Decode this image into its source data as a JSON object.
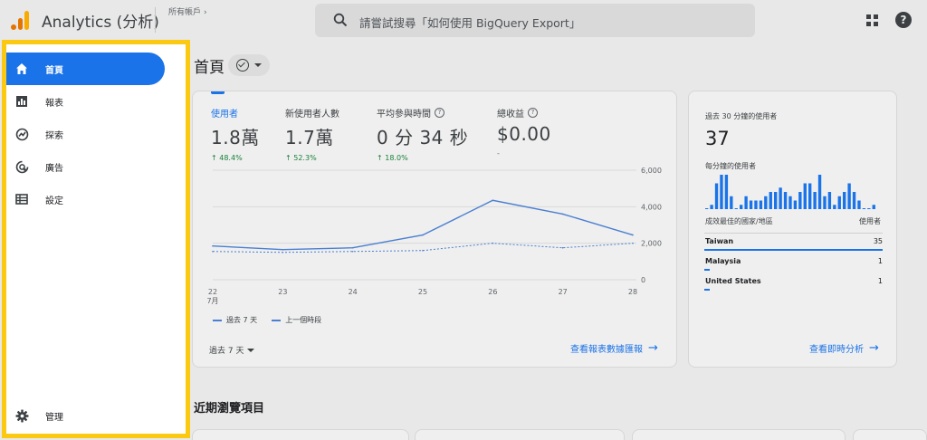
{
  "header": {
    "app_title": "Analytics (分析)",
    "breadcrumb": "所有帳戶",
    "search_placeholder": "請嘗試搜尋「如何使用 BigQuery Export」"
  },
  "sidebar": {
    "items": [
      {
        "label": "首頁",
        "icon": "home-icon",
        "active": true
      },
      {
        "label": "報表",
        "icon": "reports-icon"
      },
      {
        "label": "探索",
        "icon": "explore-icon"
      },
      {
        "label": "廣告",
        "icon": "advertising-icon"
      },
      {
        "label": "設定",
        "icon": "configure-icon"
      }
    ],
    "admin": {
      "label": "管理",
      "icon": "gear-icon"
    },
    "highlight_color": "#fcc912"
  },
  "main": {
    "page_title": "首頁",
    "metrics": [
      {
        "label": "使用者",
        "value": "1.8萬",
        "change": "48.4%",
        "active": true
      },
      {
        "label": "新使用者人數",
        "value": "1.7萬",
        "change": "52.3%"
      },
      {
        "label": "平均參與時間",
        "value": "0 分 34 秒",
        "change": "18.0%",
        "help": true
      },
      {
        "label": "總收益",
        "value": "$0.00",
        "change": "-",
        "help": true
      }
    ],
    "chart_data": {
      "type": "line",
      "x": [
        "22",
        "23",
        "24",
        "25",
        "26",
        "27",
        "28"
      ],
      "x_month_label": "7月",
      "y_ticks": [
        "6,000",
        "4,000",
        "2,000",
        "0"
      ],
      "ylim": [
        0,
        6000
      ],
      "series": [
        {
          "name": "過去 7 天",
          "style": "solid",
          "values": [
            1850,
            1650,
            1750,
            2450,
            4350,
            3600,
            2450
          ]
        },
        {
          "name": "上一個時段",
          "style": "dashed",
          "values": [
            1550,
            1500,
            1550,
            1600,
            2000,
            1750,
            2000
          ]
        }
      ]
    },
    "date_range_label": "過去 7 天",
    "view_reports_link": "查看報表數據匯報"
  },
  "realtime": {
    "label": "過去 30 分鐘的使用者",
    "value": "37",
    "per_minute_label": "每分鐘的使用者",
    "per_minute_values": [
      0,
      1,
      6,
      8,
      8,
      3,
      0,
      1,
      3,
      2,
      2,
      2,
      3,
      4,
      4,
      5,
      4,
      3,
      2,
      4,
      6,
      6,
      4,
      8,
      3,
      4,
      1,
      3,
      4,
      6,
      4,
      2,
      0,
      0,
      1
    ],
    "table_header_country": "成效最佳的國家/地區",
    "table_header_users": "使用者",
    "countries": [
      {
        "name": "Taiwan",
        "users": "35",
        "share": 1.0
      },
      {
        "name": "Malaysia",
        "users": "1",
        "share": 0.03
      },
      {
        "name": "United States",
        "users": "1",
        "share": 0.03
      }
    ],
    "link": "查看即時分析"
  },
  "recent": {
    "title": "近期瀏覽項目"
  },
  "colors": {
    "primary_blue": "#1a73e8",
    "line_blue": "#4a7fd1",
    "positive_green": "#188038",
    "logo_orange": "#e37400",
    "logo_yellow": "#f9ab00"
  }
}
